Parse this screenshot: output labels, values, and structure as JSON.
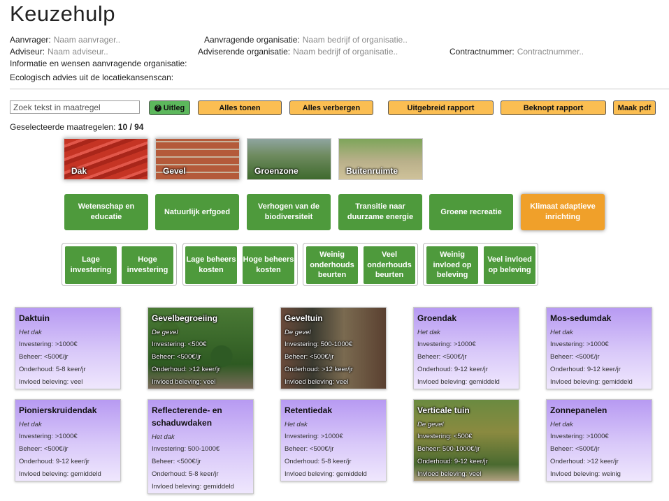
{
  "page": {
    "title": "Keuzehulp"
  },
  "form": {
    "aanvrager_label": "Aanvrager:",
    "aanvrager_placeholder": "Naam aanvrager..",
    "aanvr_org_label": "Aanvragende organisatie:",
    "aanvr_org_placeholder": "Naam bedrijf of organisatie..",
    "adviseur_label": "Adviseur:",
    "adviseur_placeholder": "Naam adviseur..",
    "advis_org_label": "Adviserende organisatie:",
    "advis_org_placeholder": "Naam bedrijf of organisatie..",
    "contract_label": "Contractnummer:",
    "contract_placeholder": "Contractnummer..",
    "info_label": "Informatie en wensen aanvragende organisatie:",
    "eco_label": "Ecologisch advies uit de locatiekansenscan:"
  },
  "toolbar": {
    "search_placeholder": "Zoek tekst in maatregel",
    "uitleg": "Uitleg",
    "alles_tonen": "Alles tonen",
    "alles_verbergen": "Alles verbergen",
    "uitgebreid": "Uitgebreid rapport",
    "beknopt": "Beknopt rapport",
    "pdf": "Maak pdf"
  },
  "selection": {
    "label": "Geselecteerde maatregelen:",
    "count": "10 / 94"
  },
  "categories": [
    "Dak",
    "Gevel",
    "Groenzone",
    "Buitenruimte"
  ],
  "themes": [
    "Wetenschap en educatie",
    "Natuurlijk erfgoed",
    "Verhogen van de biodiversiteit",
    "Transitie naar duurzame energie",
    "Groene recreatie",
    "Klimaat adaptieve inrichting"
  ],
  "filters": [
    "Lage investering",
    "Hoge investering",
    "Lage beheers kosten",
    "Hoge beheers kosten",
    "Weinig onderhouds beurten",
    "Veel onderhouds beurten",
    "Weinig invloed op beleving",
    "Veel invloed op beleving"
  ],
  "cards": [
    {
      "title": "Daktuin",
      "sub": "Het dak",
      "inv": "Investering: >1000€",
      "beh": "Beheer: <500€/jr",
      "ond": "Onderhoud: 5-8 keer/jr",
      "bel": "Invloed beleving: veel"
    },
    {
      "title": "Gevelbegroeiing",
      "sub": "De gevel",
      "inv": "Investering: <500€",
      "beh": "Beheer: <500€/jr",
      "ond": "Onderhoud: >12 keer/jr",
      "bel": "Invloed beleving: veel"
    },
    {
      "title": "Geveltuin",
      "sub": "De gevel",
      "inv": "Investering: 500-1000€",
      "beh": "Beheer: <500€/jr",
      "ond": "Onderhoud: >12 keer/jr",
      "bel": "Invloed beleving: veel"
    },
    {
      "title": "Groendak",
      "sub": "Het dak",
      "inv": "Investering: >1000€",
      "beh": "Beheer: <500€/jr",
      "ond": "Onderhoud: 9-12 keer/jr",
      "bel": "Invloed beleving: gemiddeld"
    },
    {
      "title": "Mos-sedumdak",
      "sub": "Het dak",
      "inv": "Investering: >1000€",
      "beh": "Beheer: <500€/jr",
      "ond": "Onderhoud: 9-12 keer/jr",
      "bel": "Invloed beleving: gemiddeld"
    },
    {
      "title": "Pionierskruidendak",
      "sub": "Het dak",
      "inv": "Investering: >1000€",
      "beh": "Beheer: <500€/jr",
      "ond": "Onderhoud: 9-12 keer/jr",
      "bel": "Invloed beleving: gemiddeld"
    },
    {
      "title": "Reflecterende- en schaduwdaken",
      "sub": "Het dak",
      "inv": "Investering: 500-1000€",
      "beh": "Beheer: <500€/jr",
      "ond": "Onderhoud: 5-8 keer/jr",
      "bel": "Invloed beleving: gemiddeld"
    },
    {
      "title": "Retentiedak",
      "sub": "Het dak",
      "inv": "Investering: >1000€",
      "beh": "Beheer: <500€/jr",
      "ond": "Onderhoud: 5-8 keer/jr",
      "bel": "Invloed beleving: gemiddeld"
    },
    {
      "title": "Verticale tuin",
      "sub": "De gevel",
      "inv": "Investering: <500€",
      "beh": "Beheer: 500-1000€/jr",
      "ond": "Onderhoud: 9-12 keer/jr",
      "bel": "Invloed beleving: veel"
    },
    {
      "title": "Zonnepanelen",
      "sub": "Het dak",
      "inv": "Investering: >1000€",
      "beh": "Beheer: <500€/jr",
      "ond": "Onderhoud: >12 keer/jr",
      "bel": "Invloed beleving: weinig"
    }
  ]
}
